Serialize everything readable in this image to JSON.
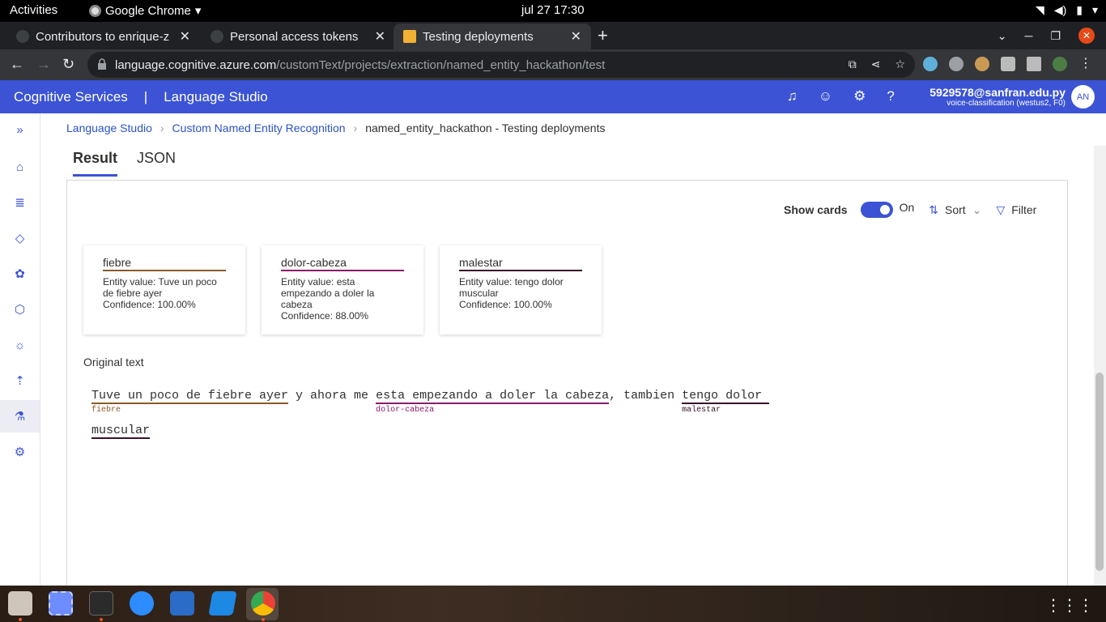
{
  "topbar": {
    "activities": "Activities",
    "app": "Google Chrome",
    "clock": "jul 27  17:30"
  },
  "tabs": [
    {
      "label": "Contributors to enrique-z",
      "active": false
    },
    {
      "label": "Personal access tokens",
      "active": false
    },
    {
      "label": "Testing deployments",
      "active": true
    }
  ],
  "address": {
    "host": "language.cognitive.azure.com",
    "path": "/customText/projects/extraction/named_entity_hackathon/test"
  },
  "header": {
    "brand": "Cognitive Services",
    "separator": "|",
    "product": "Language Studio",
    "email": "5929578@sanfran.edu.py",
    "resource": "voice-classification (westus2, F0)",
    "initials": "AN"
  },
  "breadcrumb": {
    "home": "Language Studio",
    "feature": "Custom Named Entity Recognition",
    "current": "named_entity_hackathon - Testing deployments"
  },
  "result_tabs": {
    "result": "Result",
    "json": "JSON"
  },
  "controls": {
    "show_cards": "Show cards",
    "toggle_state": "On",
    "sort": "Sort",
    "filter": "Filter"
  },
  "cards": [
    {
      "title": "fiebre",
      "value": "Entity value: Tuve un poco de fiebre ayer",
      "confidence": "Confidence: 100.00%",
      "color": "#8a5a2b"
    },
    {
      "title": "dolor-cabeza",
      "value": "Entity value: esta empezando a doler la cabeza",
      "confidence": "Confidence: 88.00%",
      "color": "#8b1a6b"
    },
    {
      "title": "malestar",
      "value": "Entity value: tengo dolor muscular",
      "confidence": "Confidence: 100.00%",
      "color": "#3a0f2a"
    }
  ],
  "original_text": {
    "label": "Original text",
    "seg1": "Tuve un poco de fiebre ayer",
    "seg1_tag": "fiebre",
    "plain1": " y ahora me ",
    "seg2": "esta empezando a doler la cabeza",
    "seg2_tag": "dolor-cabeza",
    "plain2": ", tambien ",
    "seg3a": "tengo dolor ",
    "seg3_tag": "malestar",
    "seg3b": "muscular"
  }
}
